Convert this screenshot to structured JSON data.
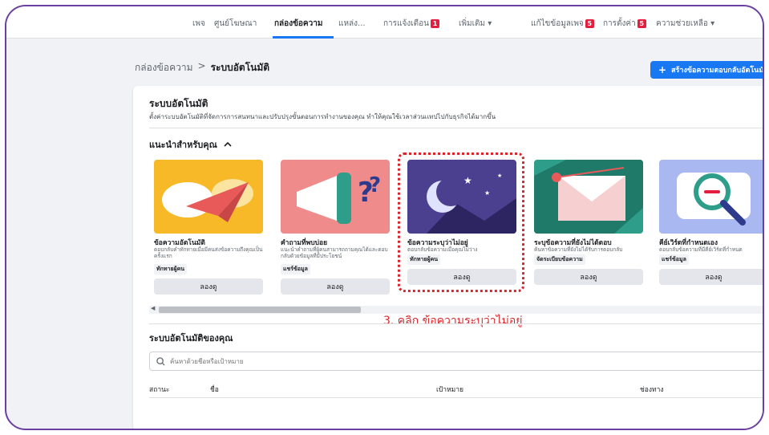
{
  "nav": {
    "items": [
      {
        "label": "เพจ"
      },
      {
        "label": "ศูนย์โฆษณา"
      },
      {
        "label": "กล่องข้อความ"
      },
      {
        "label": "แหล่ง..."
      },
      {
        "label": "การแจ้งเตือน",
        "badge": "1"
      },
      {
        "label": "เพิ่มเติม ▾"
      },
      {
        "label": "แก้ไขข้อมูลเพจ",
        "badge": "5"
      },
      {
        "label": "การตั้งค่า",
        "badge": "5"
      },
      {
        "label": "ความช่วยเหลือ ▾"
      }
    ]
  },
  "breadcrumb": {
    "parent": "กล่องข้อความ",
    "sep": ">",
    "current": "ระบบอัตโนมัติ"
  },
  "create_button": {
    "icon": "+",
    "label": "สร้างข้อความตอบกลับอัตโนมัติ"
  },
  "panel": {
    "title": "ระบบอัตโนมัติ",
    "description": "ตั้งค่าระบบอัตโนมัติที่จัดการการสนทนาและปรับปรุงขั้นตอนการทำงานของคุณ ทำให้คุณใช้เวลาส่วนเเทปไปกับธุรกิจได้มากขึ้น"
  },
  "recommended": {
    "heading": "แนะนำสำหรับคุณ",
    "cards": [
      {
        "title": "ข้อความอัตโนมัติ",
        "desc": "ตอบกลับคำทักทายเมื่อมีคนส่งข้อความถึงคุณเป็นครั้งแรก",
        "tag": "ทักทายผู้คน",
        "button": "ลองดู",
        "color": "#f7b928"
      },
      {
        "title": "คำถามที่พบบ่อย",
        "desc": "แนะนำคำถามที่ผู้คนสามารถถามคุณได้และตอบกลับด้วยข้อมูลที่มีประโยชน์",
        "tag": "แชร์ข้อมูล",
        "button": "ลองดู",
        "color": "#f08b8b"
      },
      {
        "title": "ข้อความระบุว่าไม่อยู่",
        "desc": "ตอบกลับข้อความเมื่อคุณไม่ว่าง",
        "tag": "ทักทายผู้คน",
        "button": "ลองดู",
        "color": "#4b3f8f"
      },
      {
        "title": "ระบุข้อความที่ยังไม่ได้ตอบ",
        "desc": "ค้นหาข้อความที่ยังไม่ได้รับการตอบกลับ",
        "tag": "จัดระเบียบข้อความ",
        "button": "ลองดู",
        "color": "#2e9e8a"
      },
      {
        "title": "คีย์เวิร์ดที่กำหนดเอง",
        "desc": "ตอบกลับข้อความที่มีคีย์เวิร์ดที่กำหนด",
        "tag": "แชร์ข้อมูล",
        "button": "ลองดู",
        "color": "#a9b8f0"
      }
    ]
  },
  "annotation": "3. คลิก ข้อความระบุว่าไม่อยู่",
  "my_automations": {
    "title": "ระบบอัตโนมัติของคุณ",
    "search_placeholder": "ค้นหาด้วยชื่อหรือเป้าหมาย",
    "columns": [
      "สถานะ",
      "ชื่อ",
      "เป้าหมาย",
      "ช่องทาง"
    ]
  }
}
